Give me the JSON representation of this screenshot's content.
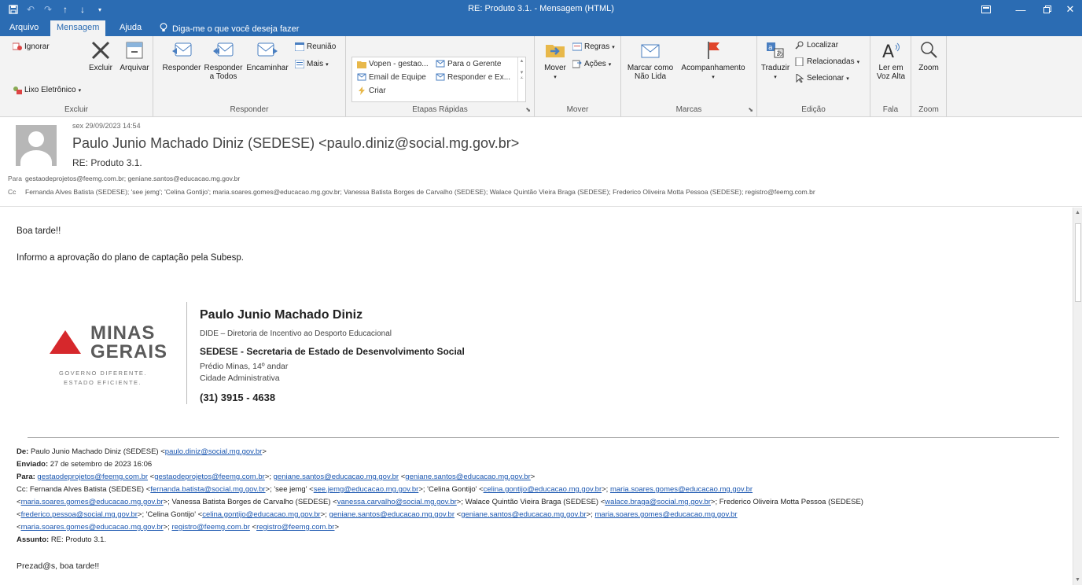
{
  "window": {
    "title": "RE: Produto 3.1.  -  Mensagem (HTML)"
  },
  "tabs": {
    "arquivo": "Arquivo",
    "mensagem": "Mensagem",
    "ajuda": "Ajuda",
    "tellme": "Diga-me o que você deseja fazer"
  },
  "ribbon": {
    "excluir": {
      "label": "Excluir",
      "ignorar": "Ignorar",
      "lixo": "Lixo Eletrônico",
      "excluir_btn": "Excluir",
      "arquivar": "Arquivar"
    },
    "responder": {
      "label": "Responder",
      "responder": "Responder",
      "responder_todos_1": "Responder",
      "responder_todos_2": "a Todos",
      "encaminhar": "Encaminhar",
      "reuniao": "Reunião",
      "mais": "Mais"
    },
    "etapas": {
      "label": "Etapas Rápidas",
      "items": [
        "Vopen - gestao...",
        "Para o Gerente",
        "Email de Equipe",
        "Responder e Ex...",
        "Criar"
      ]
    },
    "mover": {
      "label": "Mover",
      "mover": "Mover",
      "regras": "Regras",
      "acoes": "Ações"
    },
    "marcas": {
      "label": "Marcas",
      "marcar_1": "Marcar como",
      "marcar_2": "Não Lida",
      "acompanhamento": "Acompanhamento"
    },
    "edicao": {
      "label": "Edição",
      "traduzir": "Traduzir",
      "localizar": "Localizar",
      "relacionadas": "Relacionadas",
      "selecionar": "Selecionar"
    },
    "fala": {
      "label": "Fala",
      "ler_1": "Ler em",
      "ler_2": "Voz Alta"
    },
    "zoom": {
      "label": "Zoom",
      "zoom": "Zoom"
    }
  },
  "header": {
    "date": "sex 29/09/2023 14:54",
    "sender": "Paulo Junio Machado Diniz (SEDESE) <paulo.diniz@social.mg.gov.br>",
    "subject": "RE: Produto 3.1.",
    "to_label": "Para",
    "to": "gestaodeprojetos@feemg.com.br; geniane.santos@educacao.mg.gov.br",
    "cc_label": "Cc",
    "cc": "Fernanda Alves Batista (SEDESE); 'see jemg'; 'Celina Gontijo'; maria.soares.gomes@educacao.mg.gov.br; Vanessa Batista Borges de Carvalho (SEDESE); Walace Quintão Vieira Braga (SEDESE); Frederico Oliveira Motta Pessoa (SEDESE); registro@feemg.com.br"
  },
  "body": {
    "greeting": "Boa tarde!!",
    "line1": "Informo a aprovação do plano de captação pela Subesp."
  },
  "logo": {
    "word1": "MINAS",
    "word2": "GERAIS",
    "tag1": "GOVERNO DIFERENTE.",
    "tag2": "ESTADO EFICIENTE."
  },
  "signature": {
    "name": "Paulo Junio Machado Diniz",
    "dept": "DIDE – Diretoria de Incentivo ao Desporto Educacional",
    "org": "SEDESE - Secretaria de Estado de Desenvolvimento Social",
    "addr1": "Prédio Minas, 14º andar",
    "addr2": "Cidade Administrativa",
    "phone": "(31) 3915 - 4638"
  },
  "forwarded": {
    "de_label": "De:",
    "de_name": "Paulo Junio Machado Diniz (SEDESE) <",
    "de_link": "paulo.diniz@social.mg.gov.br",
    "de_end": ">",
    "enviado_label": "Enviado:",
    "enviado": "27 de setembro de 2023 16:06",
    "para_label": "Para:",
    "para_l1": "gestaodeprojetos@feemg.com.br",
    "para_t1": " <",
    "para_l2": "gestaodeprojetos@feemg.com.br",
    "para_t2": ">; ",
    "para_l3": "geniane.santos@educacao.mg.gov.br",
    "para_t3": " <",
    "para_l4": "geniane.santos@educacao.mg.gov.br",
    "para_t4": ">",
    "cc_line1_a": "Cc: Fernanda Alves Batista (SEDESE) <",
    "cc_line1_l1": "fernanda.batista@social.mg.gov.br",
    "cc_line1_b": ">; 'see jemg' <",
    "cc_line1_l2": "see.jemg@educacao.mg.gov.br",
    "cc_line1_c": ">; 'Celina Gontijo' <",
    "cc_line1_l3": "celina.gontijo@educacao.mg.gov.br",
    "cc_line1_d": ">; ",
    "cc_line1_l4": "maria.soares.gomes@educacao.mg.gov.br",
    "cc_line2_a": "<",
    "cc_line2_l1": "maria.soares.gomes@educacao.mg.gov.br",
    "cc_line2_b": ">; Vanessa Batista Borges de Carvalho (SEDESE) <",
    "cc_line2_l2": "vanessa.carvalho@social.mg.gov.br",
    "cc_line2_c": ">; Walace Quintão Vieira Braga (SEDESE) <",
    "cc_line2_l3": "walace.braga@social.mg.gov.br",
    "cc_line2_d": ">; Frederico Oliveira Motta Pessoa (SEDESE)",
    "cc_line3_a": "<",
    "cc_line3_l1": "frederico.pessoa@social.mg.gov.br",
    "cc_line3_b": ">; 'Celina Gontijo' <",
    "cc_line3_l2": "celina.gontijo@educacao.mg.gov.br",
    "cc_line3_c": ">; ",
    "cc_line3_l3": "geniane.santos@educacao.mg.gov.br",
    "cc_line3_d": " <",
    "cc_line3_l4": "geniane.santos@educacao.mg.gov.br",
    "cc_line3_e": ">; ",
    "cc_line3_l5": "maria.soares.gomes@educacao.mg.gov.br",
    "cc_line4_a": "<",
    "cc_line4_l1": "maria.soares.gomes@educacao.mg.gov.br",
    "cc_line4_b": ">; ",
    "cc_line4_l2": "registro@feemg.com.br",
    "cc_line4_c": " <",
    "cc_line4_l3": "registro@feemg.com.br",
    "cc_line4_d": ">",
    "assunto_label": "Assunto:",
    "assunto": "RE: Produto 3.1.",
    "greeting": "Prezad@s, boa tarde!!"
  }
}
